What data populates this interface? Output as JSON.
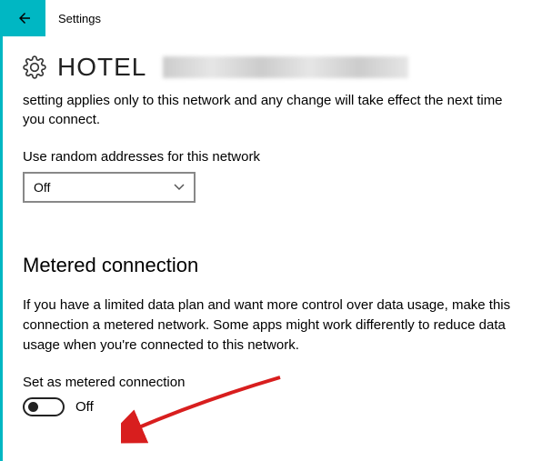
{
  "header": {
    "title": "Settings"
  },
  "network": {
    "name": "HOTEL",
    "description": "setting applies only to this network and any change will take effect the next time you connect."
  },
  "random_addresses": {
    "label": "Use random addresses for this network",
    "value": "Off"
  },
  "metered": {
    "title": "Metered connection",
    "description": "If you have a limited data plan and want more control over data usage, make this connection a metered network. Some apps might work differently to reduce data usage when you're connected to this network.",
    "toggle_label": "Set as metered connection",
    "toggle_value": "Off"
  },
  "colors": {
    "accent": "#00b7c3",
    "arrow": "#d81e1e"
  }
}
